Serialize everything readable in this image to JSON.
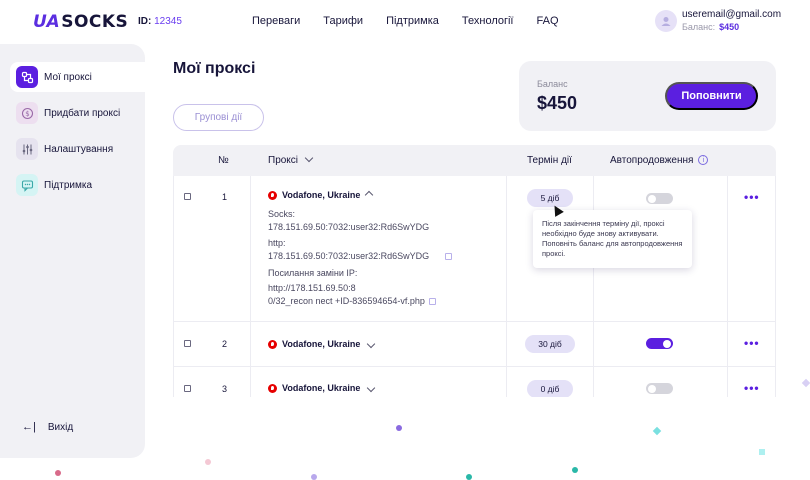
{
  "header": {
    "logo_mark": "UA",
    "logo_text": "SOCKS",
    "id_label": "ID:",
    "id_value": "12345",
    "nav": [
      "Переваги",
      "Тарифи",
      "Підтримка",
      "Технології",
      "FAQ"
    ],
    "user_email": "useremail@gmail.com",
    "balance_label": "Баланс:",
    "balance_value": "$450"
  },
  "sidebar": {
    "items": [
      {
        "label": "Мої проксі",
        "icon": "proxy-icon",
        "active": true
      },
      {
        "label": "Придбати проксі",
        "icon": "dollar-icon",
        "active": false
      },
      {
        "label": "Налаштування",
        "icon": "sliders-icon",
        "active": false
      },
      {
        "label": "Підтримка",
        "icon": "chat-icon",
        "active": false
      }
    ],
    "logout": "Вихід"
  },
  "main": {
    "title": "Мої проксі",
    "group_actions": "Групові дії",
    "balance_card": {
      "label": "Баланс",
      "amount": "$450",
      "button": "Поповнити"
    }
  },
  "table": {
    "headers": {
      "num": "№",
      "proxy": "Проксі",
      "term": "Термін дії",
      "auto": "Автопродовження"
    },
    "rows": [
      {
        "num": "1",
        "provider": "Vodafone, Ukraine",
        "expanded": true,
        "socks_label": "Socks:",
        "socks_value": "178.151.69.50:7032:user32:Rd6SwYDG",
        "http_label": "http:",
        "http_value": "178.151.69.50:7032:user32:Rd6SwYDG",
        "link_label": "Посилання заміни IP:",
        "link_line1": "http://178.151.69.50:8",
        "link_line2": "0/32_recon nect +ID-836594654-vf.php",
        "term": "5 діб",
        "auto": false
      },
      {
        "num": "2",
        "provider": "Vodafone, Ukraine",
        "expanded": false,
        "term": "30 діб",
        "auto": true
      },
      {
        "num": "3",
        "provider": "Vodafone, Ukraine",
        "expanded": false,
        "term": "0 діб",
        "auto": false
      }
    ],
    "tooltip": "Після закінчення терміну дії, проксі необхідно буде знову активувати. Поповніть баланс для автопродовження проксі."
  },
  "colors": {
    "accent": "#5b1fe0",
    "panel": "#f1f1f5",
    "pill": "#e4e1f7"
  }
}
